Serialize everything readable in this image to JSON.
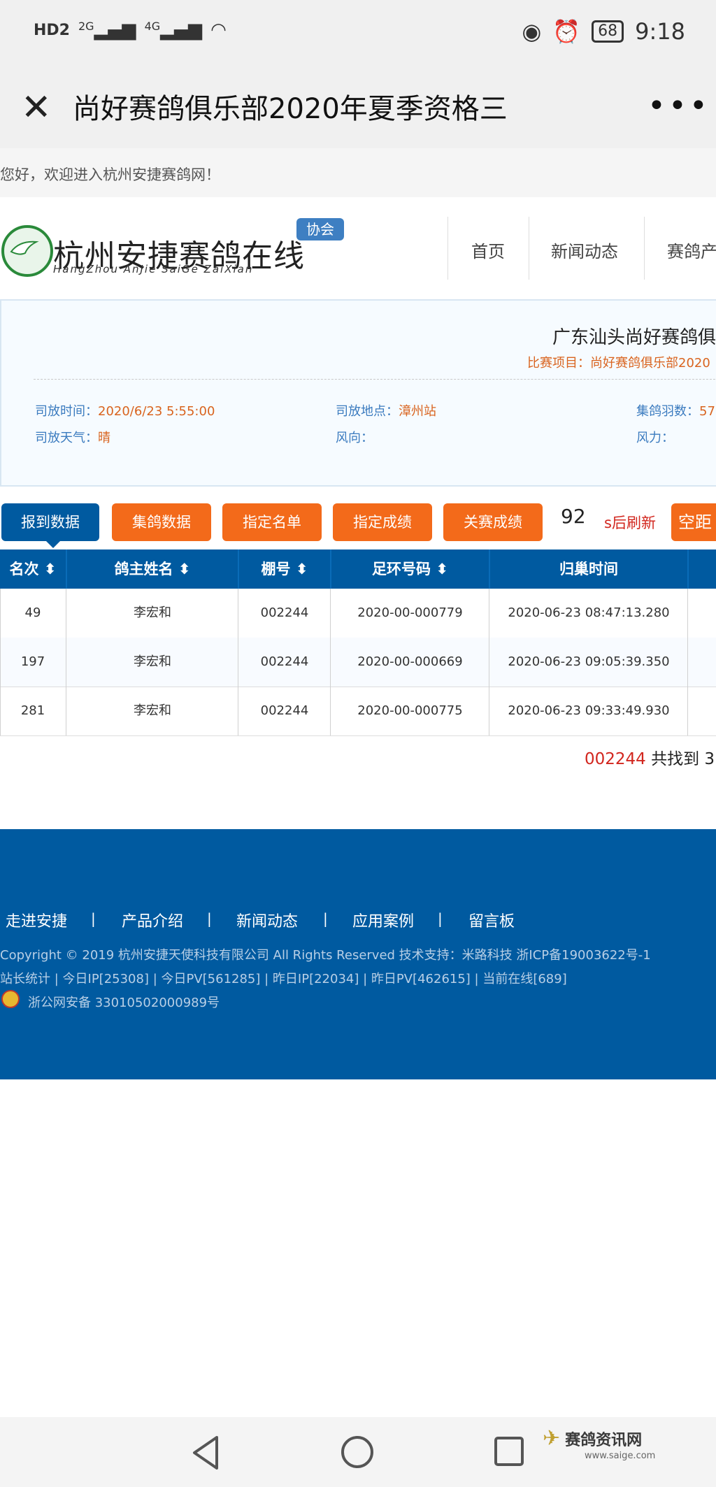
{
  "status_bar": {
    "left_indicators": [
      "HD2",
      "2G",
      "4G"
    ],
    "battery": "68",
    "time": "9:18"
  },
  "header": {
    "title": "尚好赛鸽俱乐部2020年夏季资格三"
  },
  "welcome": "您好，欢迎进入杭州安捷赛鸽网！",
  "site": {
    "logo_text": "杭州安捷赛鸽在线",
    "logo_sub": "HangZhou AnJie SaiGe ZaiXian",
    "logo_badge": "协会",
    "nav": [
      "首页",
      "新闻动态",
      "赛鸽产"
    ]
  },
  "race_info": {
    "club": "广东汕头尚好赛鸽俱",
    "project_label": "比赛项目：",
    "project_value": "尚好赛鸽俱乐部2020",
    "release_time_label": "司放时间：",
    "release_time": "2020/6/23 5:55:00",
    "release_place_label": "司放地点：",
    "release_place": "漳州站",
    "birds_label": "集鸽羽数：",
    "birds": "57",
    "weather_label": "司放天气：",
    "weather": "晴",
    "wind_dir_label": "风向：",
    "wind_dir": "",
    "wind_force_label": "风力：",
    "wind_force": ""
  },
  "buttons": [
    "报到数据",
    "集鸽数据",
    "指定名单",
    "指定成绩",
    "关赛成绩",
    "空距"
  ],
  "refresh": {
    "seconds": "92",
    "label": "s后刷新"
  },
  "table": {
    "headers": [
      "名次 ⬍",
      "鸽主姓名 ⬍",
      "棚号 ⬍",
      "足环号码 ⬍",
      "归巢时间"
    ],
    "rows": [
      [
        "49",
        "李宏和",
        "002244",
        "2020-00-000779",
        "2020-06-23 08:47:13.280"
      ],
      [
        "197",
        "李宏和",
        "002244",
        "2020-00-000669",
        "2020-06-23 09:05:39.350"
      ],
      [
        "281",
        "李宏和",
        "002244",
        "2020-00-000775",
        "2020-06-23 09:33:49.930"
      ]
    ]
  },
  "found": {
    "id": "002244",
    "text": " 共找到 3"
  },
  "footer": {
    "links": [
      "走进安捷",
      "产品介绍",
      "新闻动态",
      "应用案例",
      "留言板"
    ],
    "separator": "|",
    "copyright": "Copyright © 2019 杭州安捷天使科技有限公司 All Rights Reserved 技术支持：米路科技 浙ICP备19003622号-1",
    "stats": "站长统计 | 今日IP[25308] | 今日PV[561285] | 昨日IP[22034] | 昨日PV[462615] | 当前在线[689]",
    "police": "浙公网安备 33010502000989号"
  },
  "watermark": {
    "name": "赛鸽资讯网",
    "url": "www.saige.com"
  }
}
